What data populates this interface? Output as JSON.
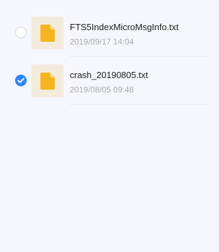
{
  "files": [
    {
      "name": "FTS5IndexMicroMsgInfo.txt",
      "date": "2019/09/17 14:04",
      "selected": false,
      "icon": "document-icon"
    },
    {
      "name": "crash_20190805.txt",
      "date": "2019/08/05 09:48",
      "selected": true,
      "icon": "document-icon"
    }
  ],
  "colors": {
    "background": "#f5f7fd",
    "accent": "#2f86f6",
    "file_icon": "#f6b51f",
    "thumb_bg": "#f3ebdc"
  }
}
